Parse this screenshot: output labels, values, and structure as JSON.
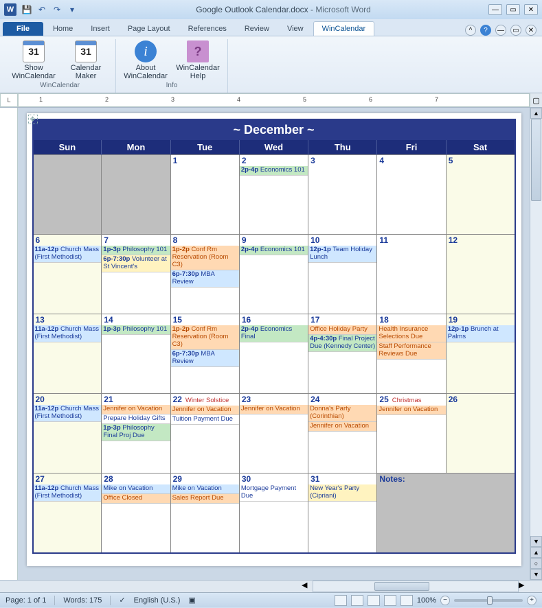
{
  "titlebar": {
    "doc_name": "Google Outlook Calendar.docx",
    "app_name": "Microsoft Word",
    "word_icon": "W"
  },
  "ribbon": {
    "tabs": [
      "File",
      "Home",
      "Insert",
      "Page Layout",
      "References",
      "Review",
      "View",
      "WinCalendar"
    ],
    "active_tab": "WinCalendar",
    "groups": [
      {
        "label": "WinCalendar",
        "items": [
          {
            "icon": "cal",
            "icon_text": "31",
            "label": "Show WinCalendar"
          },
          {
            "icon": "cal",
            "icon_text": "31",
            "label": "Calendar Maker"
          }
        ]
      },
      {
        "label": "Info",
        "items": [
          {
            "icon": "info",
            "icon_text": "i",
            "label": "About WinCalendar"
          },
          {
            "icon": "help",
            "icon_text": "?",
            "label": "WinCalendar Help"
          }
        ]
      }
    ]
  },
  "ruler": {
    "marks": [
      "1",
      "2",
      "3",
      "4",
      "5",
      "6",
      "7"
    ]
  },
  "calendar": {
    "month_title": "~ December ~",
    "days": [
      "Sun",
      "Mon",
      "Tue",
      "Wed",
      "Thu",
      "Fri",
      "Sat"
    ],
    "notes_label": "Notes:",
    "weeks": [
      [
        {
          "num": "",
          "grey": true,
          "wknd": false,
          "events": []
        },
        {
          "num": "",
          "grey": true,
          "wknd": false,
          "events": []
        },
        {
          "num": "1",
          "events": []
        },
        {
          "num": "2",
          "events": [
            {
              "cls": "green",
              "time": "2p-4p",
              "text": "Economics 101"
            }
          ]
        },
        {
          "num": "3",
          "events": []
        },
        {
          "num": "4",
          "events": []
        },
        {
          "num": "5",
          "wknd": true,
          "events": []
        }
      ],
      [
        {
          "num": "6",
          "wknd": true,
          "events": [
            {
              "cls": "blue",
              "time": "11a-12p",
              "text": "Church Mass (First Methodist)"
            }
          ]
        },
        {
          "num": "7",
          "events": [
            {
              "cls": "green",
              "time": "1p-3p",
              "text": "Philosophy 101"
            },
            {
              "cls": "yellow",
              "time": "6p-7:30p",
              "text": "Volunteer at St Vincent's"
            }
          ]
        },
        {
          "num": "8",
          "events": [
            {
              "cls": "orange",
              "time": "1p-2p",
              "text": "Conf Rm Reservation (Room C3)"
            },
            {
              "cls": "blue",
              "time": "6p-7:30p",
              "text": "MBA Review"
            }
          ]
        },
        {
          "num": "9",
          "events": [
            {
              "cls": "green",
              "time": "2p-4p",
              "text": "Economics 101"
            }
          ]
        },
        {
          "num": "10",
          "events": [
            {
              "cls": "blue",
              "time": "12p-1p",
              "text": "Team Holiday Lunch"
            }
          ]
        },
        {
          "num": "11",
          "events": []
        },
        {
          "num": "12",
          "wknd": true,
          "events": []
        }
      ],
      [
        {
          "num": "13",
          "wknd": true,
          "events": [
            {
              "cls": "blue",
              "time": "11a-12p",
              "text": "Church Mass (First Methodist)"
            }
          ]
        },
        {
          "num": "14",
          "events": [
            {
              "cls": "green",
              "time": "1p-3p",
              "text": "Philosophy 101"
            }
          ]
        },
        {
          "num": "15",
          "events": [
            {
              "cls": "orange",
              "time": "1p-2p",
              "text": "Conf Rm Reservation (Room C3)"
            },
            {
              "cls": "blue",
              "time": "6p-7:30p",
              "text": "MBA Review"
            }
          ]
        },
        {
          "num": "16",
          "events": [
            {
              "cls": "green",
              "time": "2p-4p",
              "text": "Economics Final"
            }
          ]
        },
        {
          "num": "17",
          "events": [
            {
              "cls": "orange",
              "time": "",
              "text": "Office Holiday Party"
            },
            {
              "cls": "green",
              "time": "4p-4:30p",
              "text": "Final Project Due (Kennedy Center)"
            }
          ]
        },
        {
          "num": "18",
          "events": [
            {
              "cls": "orange",
              "time": "",
              "text": "Health Insurance Selections Due"
            },
            {
              "cls": "orange",
              "time": "",
              "text": "Staff Performance Reviews Due"
            }
          ]
        },
        {
          "num": "19",
          "wknd": true,
          "events": [
            {
              "cls": "blue",
              "time": "12p-1p",
              "text": "Brunch at Palms"
            }
          ]
        }
      ],
      [
        {
          "num": "20",
          "wknd": true,
          "events": [
            {
              "cls": "blue",
              "time": "11a-12p",
              "text": "Church Mass (First Methodist)"
            }
          ]
        },
        {
          "num": "21",
          "events": [
            {
              "cls": "orange",
              "time": "",
              "text": "Jennifer on Vacation"
            },
            {
              "cls": "blue-text",
              "time": "",
              "text": "Prepare Holiday Gifts"
            },
            {
              "cls": "green",
              "time": "1p-3p",
              "text": "Philosophy Final Proj Due"
            }
          ]
        },
        {
          "num": "22",
          "header": {
            "cls": "red-text",
            "text": "Winter Solstice"
          },
          "events": [
            {
              "cls": "orange",
              "time": "",
              "text": "Jennifer on Vacation"
            },
            {
              "cls": "blue-text",
              "time": "",
              "text": "Tuition Payment Due"
            }
          ]
        },
        {
          "num": "23",
          "events": [
            {
              "cls": "orange",
              "time": "",
              "text": "Jennifer on Vacation"
            }
          ]
        },
        {
          "num": "24",
          "events": [
            {
              "cls": "orange",
              "time": "",
              "text": "Donna's Party (Corinthian)"
            },
            {
              "cls": "orange",
              "time": "",
              "text": "Jennifer on Vacation"
            }
          ]
        },
        {
          "num": "25",
          "header": {
            "cls": "red-text",
            "text": "Christmas"
          },
          "events": [
            {
              "cls": "orange",
              "time": "",
              "text": "Jennifer on Vacation"
            }
          ]
        },
        {
          "num": "26",
          "wknd": true,
          "events": []
        }
      ],
      [
        {
          "num": "27",
          "wknd": true,
          "events": [
            {
              "cls": "blue",
              "time": "11a-12p",
              "text": "Church Mass (First Methodist)"
            }
          ]
        },
        {
          "num": "28",
          "events": [
            {
              "cls": "blue",
              "time": "",
              "text": "Mike on Vacation"
            },
            {
              "cls": "orange",
              "time": "",
              "text": "Office Closed"
            }
          ]
        },
        {
          "num": "29",
          "events": [
            {
              "cls": "blue",
              "time": "",
              "text": "Mike on Vacation"
            },
            {
              "cls": "orange",
              "time": "",
              "text": "Sales Report Due"
            }
          ]
        },
        {
          "num": "30",
          "events": [
            {
              "cls": "blue-text",
              "time": "",
              "text": "Mortgage Payment Due"
            }
          ]
        },
        {
          "num": "31",
          "events": [
            {
              "cls": "yellow",
              "time": "",
              "text": "New Year's Party (Cipriani)"
            }
          ]
        },
        {
          "num": "",
          "grey": true,
          "notes": true,
          "colspan": 2,
          "events": []
        }
      ]
    ]
  },
  "status": {
    "page": "Page: 1 of 1",
    "words": "Words: 175",
    "lang": "English (U.S.)",
    "zoom": "100%"
  }
}
